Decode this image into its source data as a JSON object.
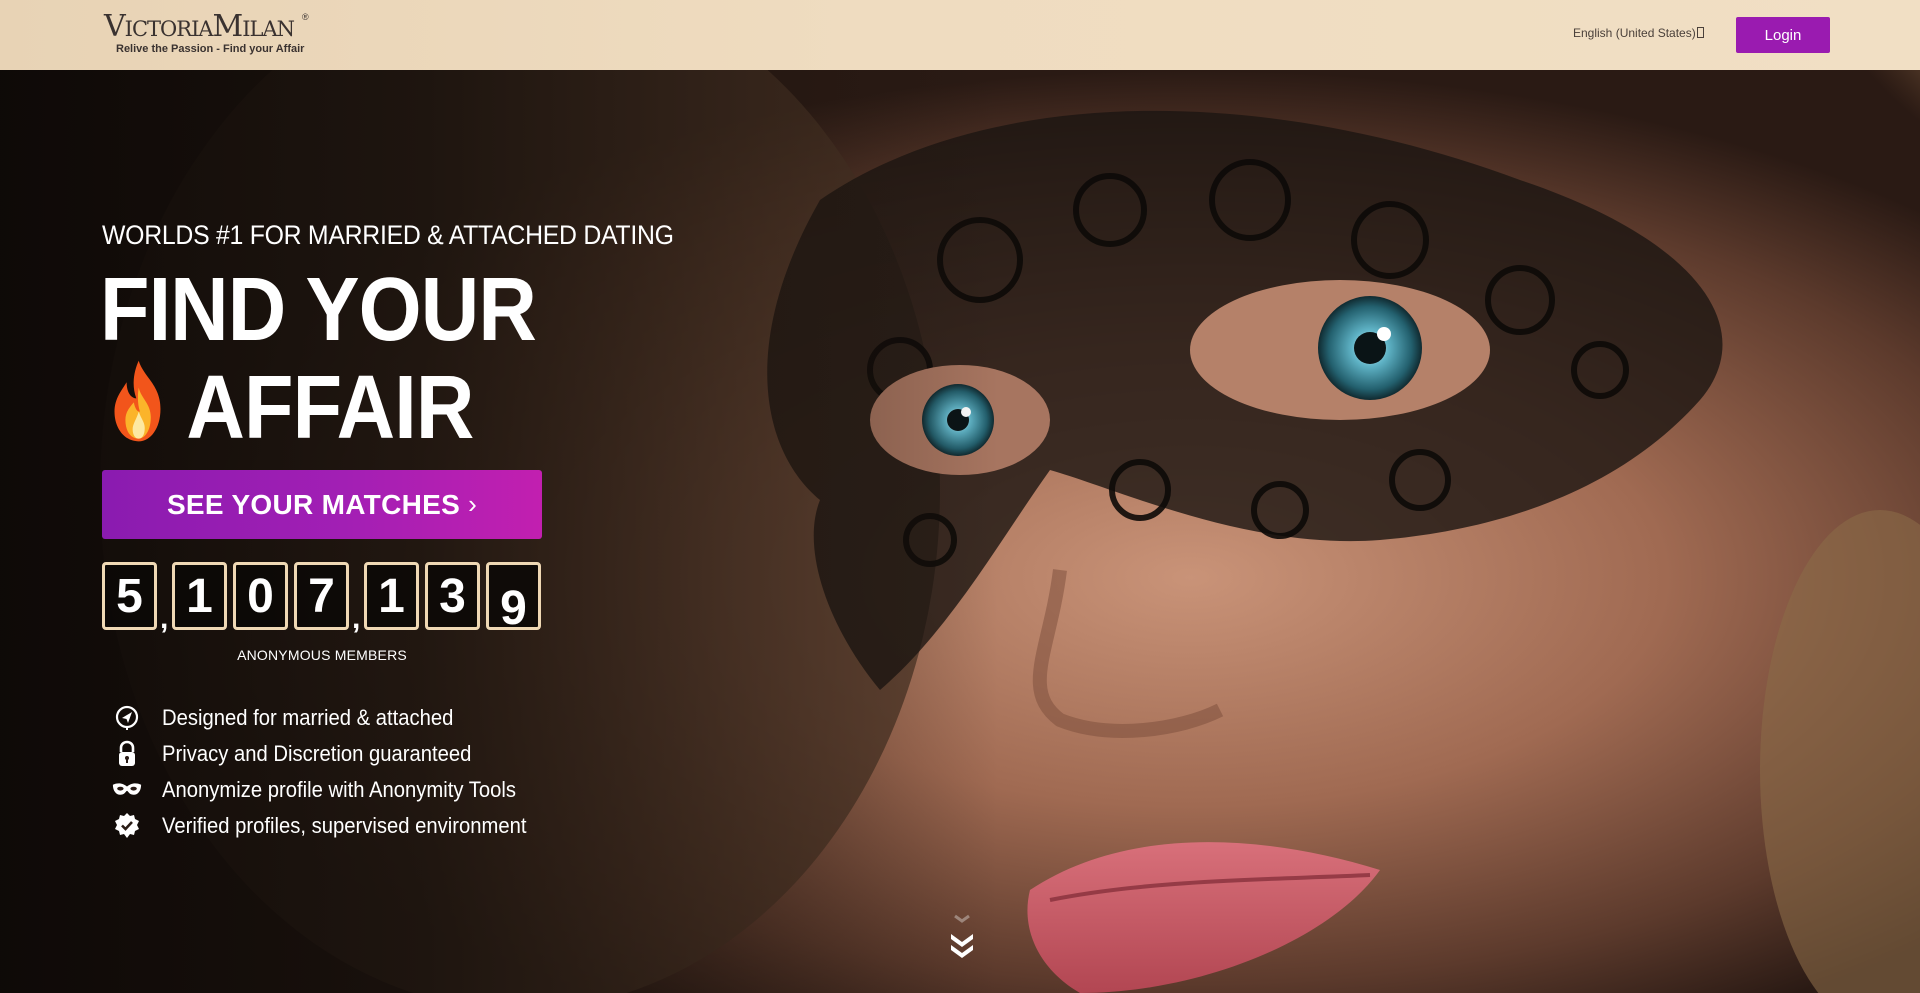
{
  "header": {
    "logo_text": "VictoriaMilan",
    "logo_registered": "®",
    "logo_tagline": "Relive the Passion - Find your Affair",
    "language": "English (United States)",
    "login_label": "Login"
  },
  "hero": {
    "tagline": "WORLDS #1 FOR MARRIED & ATTACHED DATING",
    "headline_line1": "FIND YOUR",
    "headline_line2": "AFFAIR",
    "cta_label": "SEE YOUR MATCHES",
    "cta_icon": "chevron-right-icon",
    "counter": {
      "digits": [
        "5",
        "1",
        "0",
        "7",
        "1",
        "3",
        "9"
      ],
      "separator": ",",
      "label": "ANONYMOUS MEMBERS"
    },
    "features": [
      {
        "icon": "location-arrow-icon",
        "text": "Designed for married & attached"
      },
      {
        "icon": "lock-icon",
        "text": "Privacy and Discretion guaranteed"
      },
      {
        "icon": "mask-icon",
        "text": "Anonymize profile with Anonymity Tools"
      },
      {
        "icon": "verified-check-icon",
        "text": "Verified profiles, supervised environment"
      }
    ],
    "scroll_icon": "double-chevron-down-icon"
  },
  "colors": {
    "brand_purple": "#9a1bb0",
    "cta_gradient_end": "#c21fb0",
    "header_beige": "#efdcc0",
    "counter_border": "#efd8b4"
  }
}
